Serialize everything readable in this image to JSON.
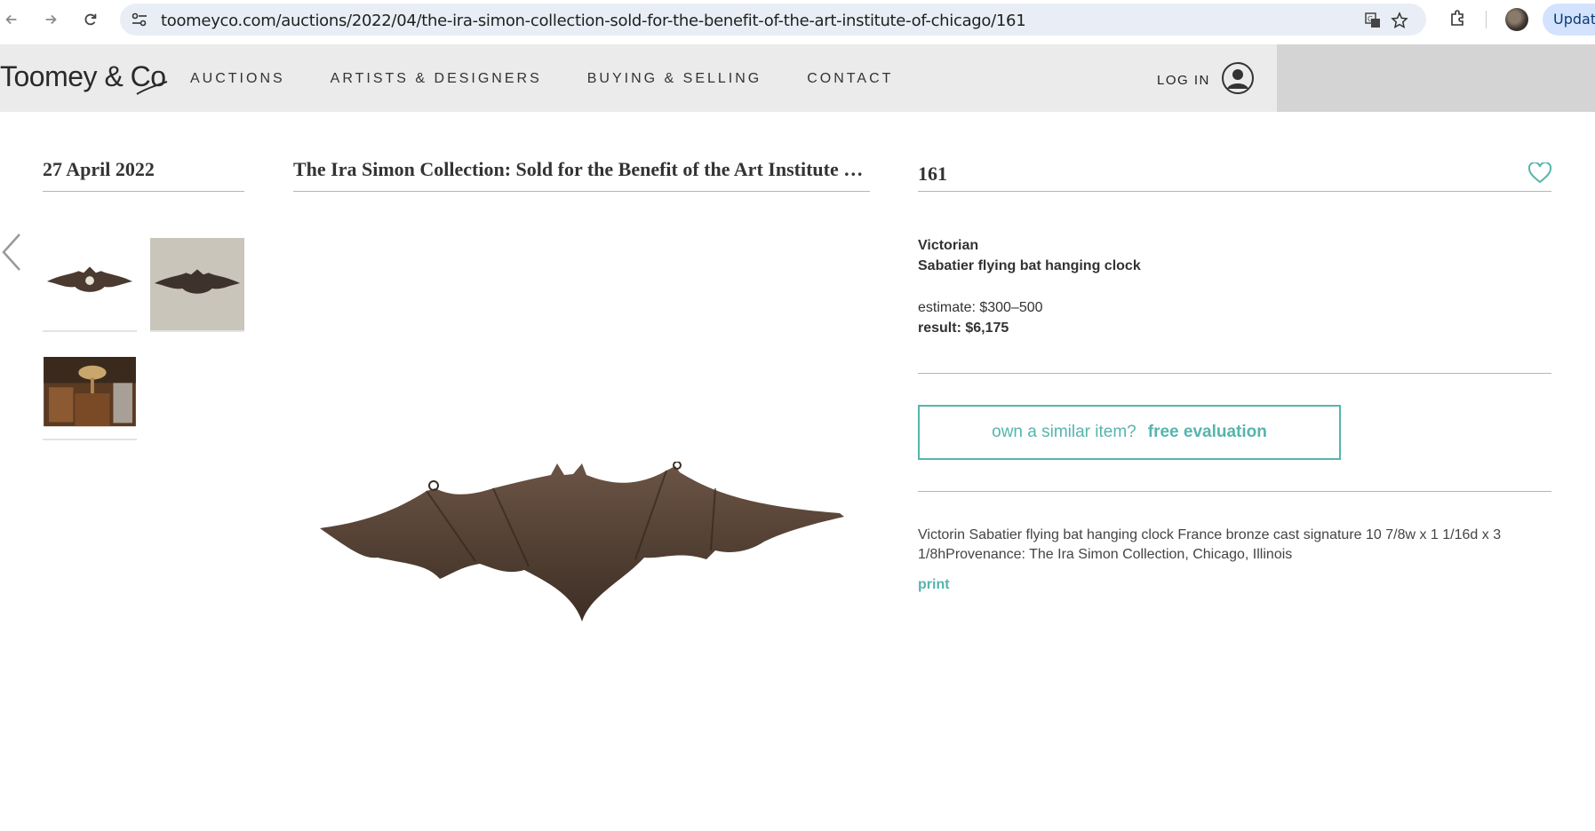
{
  "browser": {
    "url": "toomeyco.com/auctions/2022/04/the-ira-simon-collection-sold-for-the-benefit-of-the-art-institute-of-chicago/161",
    "update_label": "Update"
  },
  "header": {
    "logo_text": "Toomey & Co",
    "nav": [
      "AUCTIONS",
      "ARTISTS & DESIGNERS",
      "BUYING & SELLING",
      "CONTACT"
    ],
    "login_label": "LOG IN"
  },
  "sale": {
    "date": "27 April 2022",
    "title": "The Ira Simon Collection: Sold for the Benefit of the Art Institute of Chicago"
  },
  "lot": {
    "number": "161",
    "category": "Victorian",
    "name": "Sabatier flying bat hanging clock",
    "estimate": "estimate: $300–500",
    "result": "result: $6,175",
    "evaluation_prompt": "own a similar item?",
    "evaluation_link": "free evaluation",
    "description": "Victorin Sabatier flying bat hanging clock France bronze cast signature 10 7/8w x 1 1/16d x 3 1/8hProvenance: The Ira Simon Collection, Chicago, Illinois",
    "print_label": "print"
  },
  "thumbnails": [
    "bat-clock-front",
    "bat-clock-back",
    "room-installation"
  ],
  "colors": {
    "accent": "#55b5ac",
    "header_bg": "#ebebeb",
    "bronze": "#5a4636"
  }
}
